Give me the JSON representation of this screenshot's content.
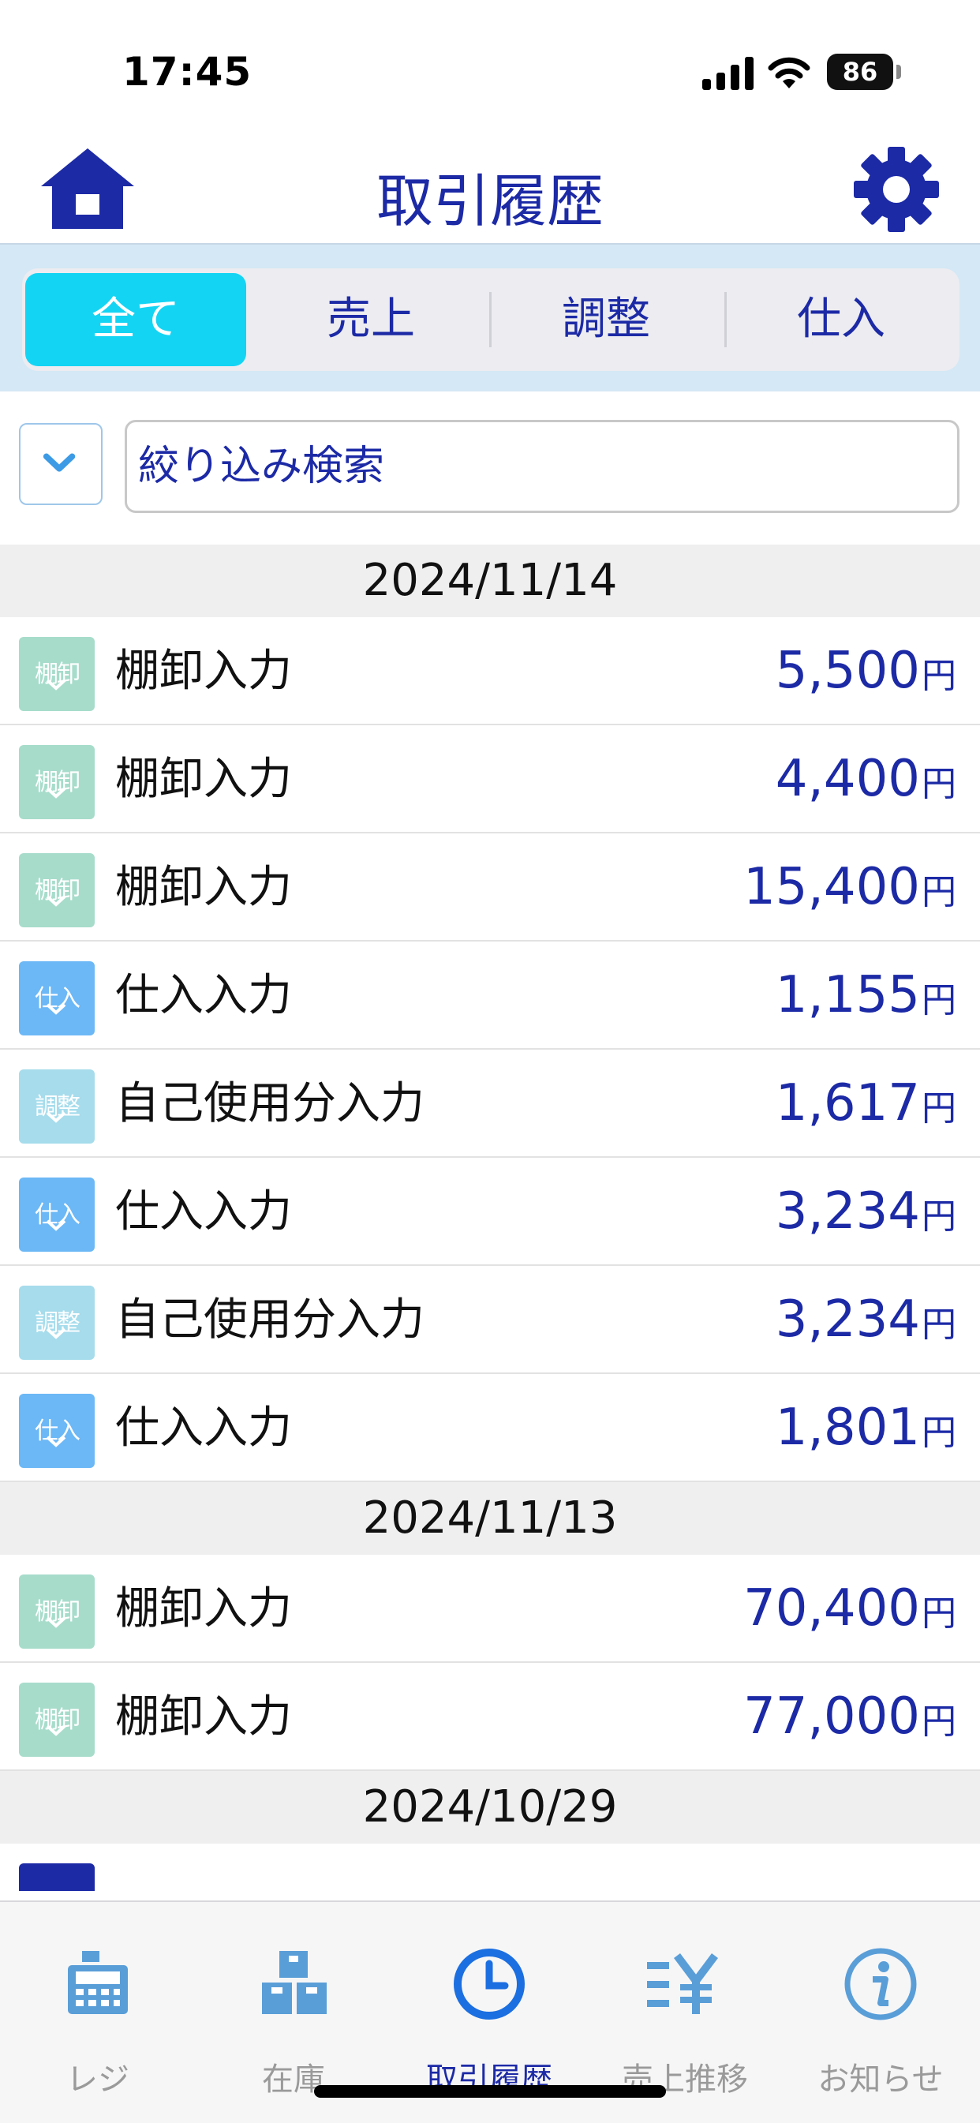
{
  "status_bar": {
    "time": "17:45",
    "battery": "86"
  },
  "header": {
    "title": "取引履歴"
  },
  "tabs": [
    {
      "label": "全て",
      "active": true
    },
    {
      "label": "売上",
      "active": false
    },
    {
      "label": "調整",
      "active": false
    },
    {
      "label": "仕入",
      "active": false
    }
  ],
  "filter": {
    "placeholder": "絞り込み検索"
  },
  "groups": [
    {
      "date": "2024/11/14",
      "items": [
        {
          "badge": "棚卸",
          "type": "stocktake",
          "label": "棚卸入力",
          "amount": "5,500",
          "unit": "円"
        },
        {
          "badge": "棚卸",
          "type": "stocktake",
          "label": "棚卸入力",
          "amount": "4,400",
          "unit": "円"
        },
        {
          "badge": "棚卸",
          "type": "stocktake",
          "label": "棚卸入力",
          "amount": "15,400",
          "unit": "円"
        },
        {
          "badge": "仕入",
          "type": "purchase",
          "label": "仕入入力",
          "amount": "1,155",
          "unit": "円"
        },
        {
          "badge": "調整",
          "type": "adjust",
          "label": "自己使用分入力",
          "amount": "1,617",
          "unit": "円"
        },
        {
          "badge": "仕入",
          "type": "purchase",
          "label": "仕入入力",
          "amount": "3,234",
          "unit": "円"
        },
        {
          "badge": "調整",
          "type": "adjust",
          "label": "自己使用分入力",
          "amount": "3,234",
          "unit": "円"
        },
        {
          "badge": "仕入",
          "type": "purchase",
          "label": "仕入入力",
          "amount": "1,801",
          "unit": "円"
        }
      ]
    },
    {
      "date": "2024/11/13",
      "items": [
        {
          "badge": "棚卸",
          "type": "stocktake",
          "label": "棚卸入力",
          "amount": "70,400",
          "unit": "円"
        },
        {
          "badge": "棚卸",
          "type": "stocktake",
          "label": "棚卸入力",
          "amount": "77,000",
          "unit": "円"
        }
      ]
    },
    {
      "date": "2024/10/29",
      "items": []
    }
  ],
  "badge_colors": {
    "stocktake": "#a7dccb",
    "purchase": "#6cb8f6",
    "adjust": "#a6dcec"
  },
  "accent_color": "#1c2aa6",
  "bottom_nav": [
    {
      "label": "レジ",
      "icon": "cash-register-icon",
      "active": false
    },
    {
      "label": "在庫",
      "icon": "boxes-icon",
      "active": false
    },
    {
      "label": "取引履歴",
      "icon": "clock-icon",
      "active": true
    },
    {
      "label": "売上推移",
      "icon": "yen-chart-icon",
      "active": false
    },
    {
      "label": "お知らせ",
      "icon": "info-icon",
      "active": false
    }
  ]
}
